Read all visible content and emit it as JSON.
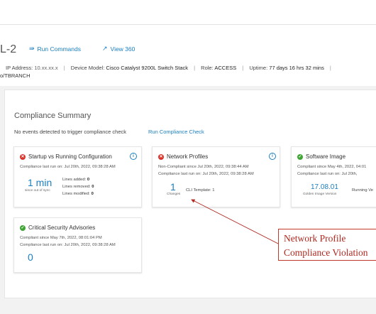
{
  "header": {
    "device_title": "L-2",
    "run_commands_label": "Run Commands",
    "view360_label": "View 360",
    "ip_label": "IP Address:",
    "ip_value": "10.xx.xx.x",
    "model_label": "Device Model:",
    "model_value": "Cisco Catalyst 9200L Switch Stack",
    "role_label": "Role:",
    "role_value": "ACCESS",
    "uptime_label": "Uptime:",
    "uptime_value": "77 days 16 hrs 32 mins",
    "location": "o/TBRANCH"
  },
  "compliance": {
    "title": "Compliance Summary",
    "no_events": "No events detected to trigger compliance check",
    "run_check_label": "Run Compliance Check",
    "cards": {
      "startup": {
        "title": "Startup vs Running Configuration",
        "last_run": "Compliance last run on: Jul 20th, 2022, 09:38:28 AM",
        "big_value": "1 min",
        "big_caption": "since out of sync",
        "lines_added_label": "Lines added:",
        "lines_added": "0",
        "lines_removed_label": "Lines removed:",
        "lines_removed": "0",
        "lines_modified_label": "Lines modified:",
        "lines_modified": "0"
      },
      "network": {
        "title": "Network Profiles",
        "status_line": "Non-Compliant since Jul 20th, 2022, 09:38:44 AM",
        "last_run": "Compliance last run on: Jul 20th, 2022, 09:38:28 AM",
        "big_value": "1",
        "big_caption": "Changes",
        "cli_template": "CLI Template: 1"
      },
      "software": {
        "title": "Software Image",
        "status_line": "Compliant since May 4th, 2022, 04:01",
        "last_run": "Compliance last run on: Jul 20th,",
        "big_value": "17.08.01",
        "big_caption": "Golden Image Version",
        "running": "Running Ve"
      },
      "security": {
        "title": "Critical Security Advisories",
        "status_line": "Compliant since May 7th, 2022, 08:01:04 PM",
        "last_run": "Compliance last run on: Jul 20th, 2022, 09:38:28 AM",
        "big_value": "0"
      }
    }
  },
  "annotation": {
    "line1": "Network Profile",
    "line2": "Compliance Violation"
  },
  "colors": {
    "accent": "#1a7fc1",
    "error": "#d9342b",
    "success": "#3fa534",
    "annotation": "#b0281f"
  },
  "icons": {
    "run_commands": "terminal-icon",
    "view360": "external-link-icon",
    "status_bad": "error-x-icon",
    "status_good": "check-icon",
    "info": "info-icon"
  }
}
